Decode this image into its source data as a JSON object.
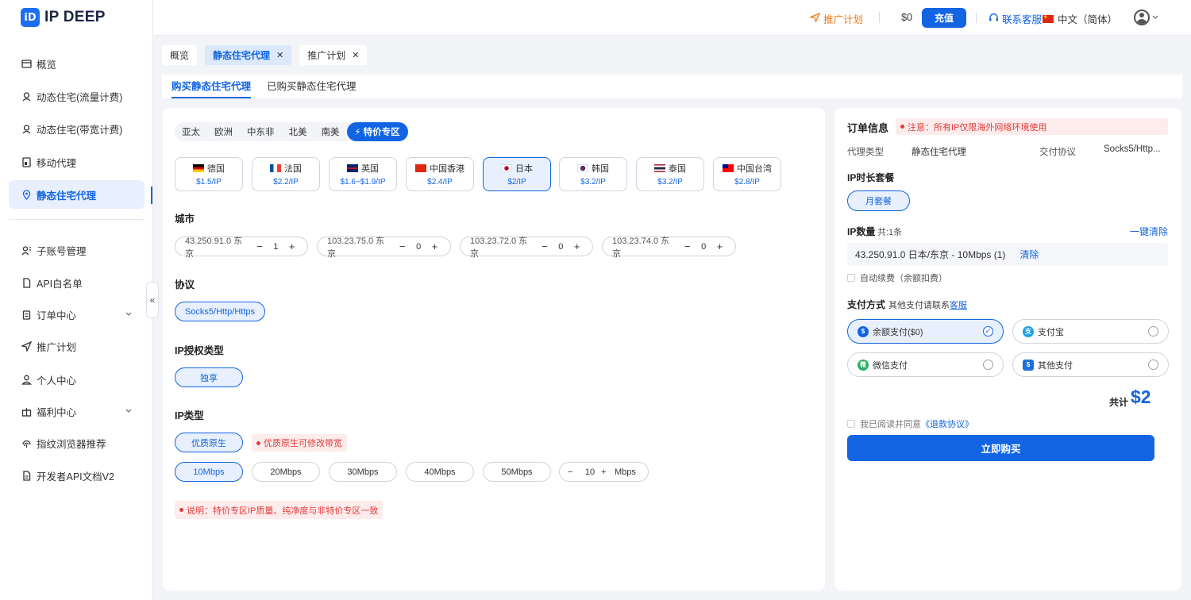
{
  "brand": {
    "logo_mark": "iD",
    "name": "IP DEEP"
  },
  "sidebar": {
    "items": [
      {
        "label": "概览",
        "icon": "overview-icon"
      },
      {
        "label": "动态住宅(流量计费)",
        "icon": "user-location-icon"
      },
      {
        "label": "动态住宅(带宽计费)",
        "icon": "user-location-icon"
      },
      {
        "label": "移动代理",
        "icon": "mobile-icon"
      },
      {
        "label": "静态住宅代理",
        "icon": "location-pin-icon",
        "active": true
      },
      {
        "label": "子账号管理",
        "icon": "sub-account-icon"
      },
      {
        "label": "API白名单",
        "icon": "document-icon"
      },
      {
        "label": "订单中心",
        "icon": "clipboard-icon"
      },
      {
        "label": "推广计划",
        "icon": "send-icon"
      },
      {
        "label": "个人中心",
        "icon": "person-icon"
      },
      {
        "label": "福利中心",
        "icon": "gift-icon"
      },
      {
        "label": "指纹浏览器推荐",
        "icon": "fingerprint-icon"
      },
      {
        "label": "开发者API文档V2",
        "icon": "doc-icon"
      }
    ],
    "collapse_glyph": "«"
  },
  "header": {
    "promo": "推广计划",
    "balance": "$0",
    "recharge": "充值",
    "support": "联系客服",
    "language": "中文（简体）"
  },
  "tabs": [
    {
      "label": "概览",
      "closable": false
    },
    {
      "label": "静态住宅代理",
      "closable": true,
      "active": true
    },
    {
      "label": "推广计划",
      "closable": true
    }
  ],
  "subnav": {
    "buy": "购买静态住宅代理",
    "purchased": "已购买静态住宅代理"
  },
  "regions": [
    "亚太",
    "欧洲",
    "中东非",
    "北美",
    "南美",
    "特价专区"
  ],
  "countries": [
    {
      "name": "德国",
      "price": "$1.5/IP"
    },
    {
      "name": "法国",
      "price": "$2.2/IP"
    },
    {
      "name": "英国",
      "price": "$1.6~$1.9/IP"
    },
    {
      "name": "中国香港",
      "price": "$2.4/IP"
    },
    {
      "name": "日本",
      "price": "$2/IP",
      "active": true
    },
    {
      "name": "韩国",
      "price": "$3.2/IP"
    },
    {
      "name": "泰国",
      "price": "$3.2/IP"
    },
    {
      "name": "中国台湾",
      "price": "$2.8/IP"
    }
  ],
  "sections": {
    "city": "城市",
    "protocol": "协议",
    "auth": "IP授权类型",
    "iptype": "IP类型"
  },
  "cities": [
    {
      "label": "43.250.91.0 东京",
      "qty": "1"
    },
    {
      "label": "103.23.75.0 东京",
      "qty": "0"
    },
    {
      "label": "103.23.72.0 东京",
      "qty": "0"
    },
    {
      "label": "103.23.74.0 东京",
      "qty": "0"
    }
  ],
  "protocol": "Socks5/Http/Https",
  "auth_type": "独享",
  "ip_type": "优质原生",
  "ip_type_note": "优质原生可修改带宽",
  "bandwidths": [
    "10Mbps",
    "20Mbps",
    "30Mbps",
    "40Mbps",
    "50Mbps"
  ],
  "custom_bw": {
    "value": "10",
    "unit": "Mbps"
  },
  "bottom_note": "说明：特价专区IP质量、纯净度与非特价专区一致",
  "order": {
    "title": "订单信息",
    "notice": "注意：所有IP仅限海外网络环境使用",
    "proxy_type_label": "代理类型",
    "proxy_type_value": "静态住宅代理",
    "protocol_label": "交付协议",
    "protocol_value": "Socks5/Http...",
    "duration_title": "IP时长套餐",
    "duration_option": "月套餐",
    "qty_title": "IP数量",
    "qty_count": "共:1条",
    "clear_all": "一键清除",
    "item": "43.250.91.0 日本/东京 - 10Mbps (1)",
    "item_clear": "清除",
    "auto_renew": "自动续费（余额扣费）",
    "pay_title": "支付方式",
    "pay_hint": "其他支付请联系",
    "pay_hint_link": "客服",
    "payments": [
      {
        "label": "余额支付($0)",
        "icon": "balance-icon",
        "active": true
      },
      {
        "label": "支付宝",
        "icon": "alipay-icon"
      },
      {
        "label": "微信支付",
        "icon": "wechat-icon"
      },
      {
        "label": "其他支付",
        "icon": "other-pay-icon"
      }
    ],
    "total_label": "共计",
    "total_value": "$2",
    "agree_text": "我已阅读并同意",
    "agree_link": "《退款协议》",
    "buy": "立即购买"
  },
  "colors": {
    "accent": "#1264e3",
    "warning": "#e23b3b",
    "promo": "#f07a18"
  }
}
